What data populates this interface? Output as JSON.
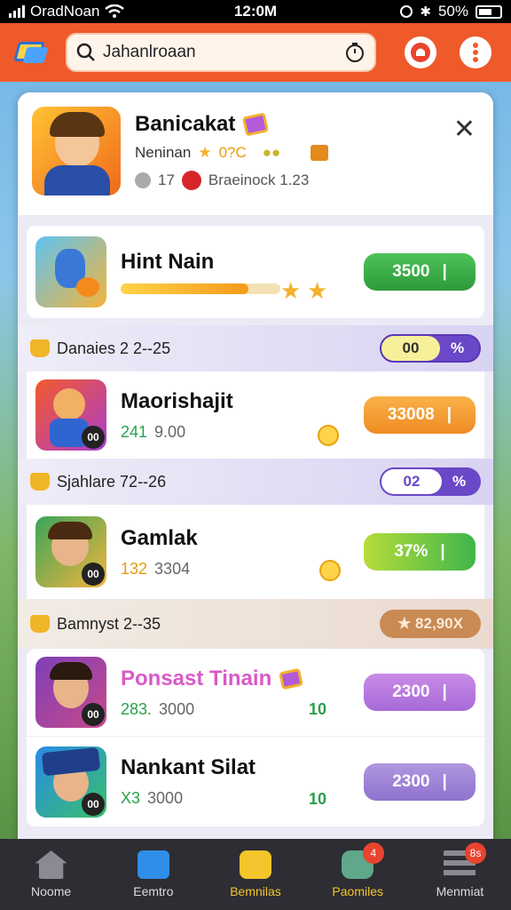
{
  "status_bar": {
    "carrier": "OradNoan",
    "time": "12:0M",
    "battery": "50%"
  },
  "header": {
    "search_query": "Jahanlroaan"
  },
  "profile": {
    "name": "Banicakat",
    "subtitle": "Neninan",
    "points": "0?C",
    "meta_count": "17",
    "meta_text": "Braeinock 1.23",
    "close_icon": "close-icon"
  },
  "games": [
    {
      "title": "Hint Nain",
      "button": "3500",
      "progress": 0.8
    },
    {
      "title": "Maorishajit",
      "stat_a": "241",
      "stat_b": "9.00",
      "button": "33008"
    },
    {
      "title": "Gamlak",
      "stat_a": "132",
      "stat_b": "3304",
      "button": "37%"
    },
    {
      "title": "Ponsast Tinain",
      "stat_a": "283.",
      "stat_b": "3000",
      "button": "2300"
    },
    {
      "title": "Nankant Silat",
      "stat_a": "X3",
      "stat_b": "3000",
      "button": "2300"
    }
  ],
  "bands": [
    {
      "label": "Danaies 2 2--25",
      "badge_a": "00",
      "badge_b": "%"
    },
    {
      "label": "Sjahlare 72--26",
      "badge_a": "02",
      "badge_b": "%"
    },
    {
      "label": "Bamnyst 2--35",
      "badge": "★ 82,90X"
    }
  ],
  "avatar_badge": "00",
  "nav": [
    {
      "label": "Noome"
    },
    {
      "label": "Eemtro"
    },
    {
      "label": "Bemnilas"
    },
    {
      "label": "Paomiles",
      "badge": "4"
    },
    {
      "label": "Menmiat",
      "badge": "8s"
    }
  ],
  "colors": {
    "header": "#ef5a2a",
    "green": "#3db54a",
    "orange": "#f5a02d",
    "purple": "#b77fe0",
    "lavender": "#a58bd8"
  }
}
